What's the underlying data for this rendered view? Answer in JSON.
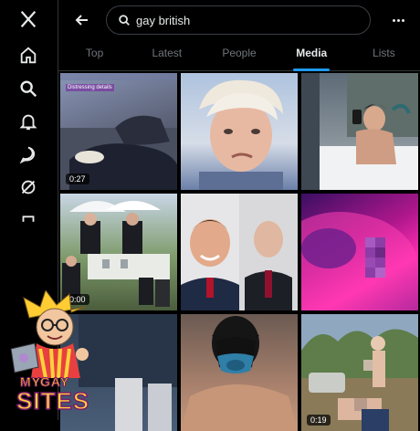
{
  "search": {
    "value": "gay british",
    "placeholder": "Search"
  },
  "tabs": [
    "Top",
    "Latest",
    "People",
    "Media",
    "Lists"
  ],
  "active_tab": "Media",
  "accent": "#1d9bf0",
  "nav": {
    "icons": [
      "x-logo-icon",
      "home-icon",
      "search-icon",
      "notifications-icon",
      "messages-icon",
      "grok-icon",
      "bookmarks-icon"
    ]
  },
  "media": {
    "tile1": {
      "duration": "0:27",
      "overlay_caption": "Distressing details"
    },
    "tile4": {
      "duration": "0:00"
    },
    "tile9": {
      "duration": "0:19"
    }
  },
  "watermark": {
    "line1": "MY",
    "line2": "GAY",
    "line3": "SITES"
  }
}
